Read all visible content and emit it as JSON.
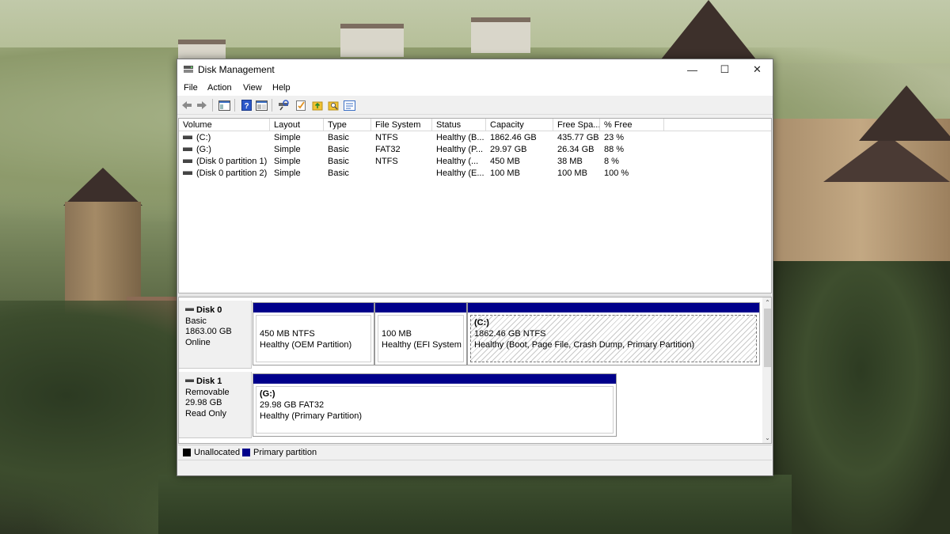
{
  "window": {
    "title": "Disk Management",
    "controls": {
      "minimize": "—",
      "maximize": "☐",
      "close": "✕"
    }
  },
  "menu": [
    "File",
    "Action",
    "View",
    "Help"
  ],
  "toolbar_icons": [
    "back-arrow-icon",
    "forward-arrow-icon",
    "console-tree-icon",
    "help-icon",
    "properties-icon",
    "rescan-disks-icon",
    "checklist-icon",
    "folder-up-icon",
    "folder-search-icon",
    "settings-panel-icon"
  ],
  "volume_list": {
    "columns": [
      "Volume",
      "Layout",
      "Type",
      "File System",
      "Status",
      "Capacity",
      "Free Spa...",
      "% Free"
    ],
    "rows": [
      [
        "(C:)",
        "Simple",
        "Basic",
        "NTFS",
        "Healthy (B...",
        "1862.46 GB",
        "435.77 GB",
        "23 %"
      ],
      [
        "(G:)",
        "Simple",
        "Basic",
        "FAT32",
        "Healthy (P...",
        "29.97 GB",
        "26.34 GB",
        "88 %"
      ],
      [
        "(Disk 0 partition 1)",
        "Simple",
        "Basic",
        "NTFS",
        "Healthy (...",
        "450 MB",
        "38 MB",
        "8 %"
      ],
      [
        "(Disk 0 partition 2)",
        "Simple",
        "Basic",
        "",
        "Healthy (E...",
        "100 MB",
        "100 MB",
        "100 %"
      ]
    ]
  },
  "disks": [
    {
      "name": "Disk 0",
      "type": "Basic",
      "size": "1863.00 GB",
      "state": "Online",
      "partitions": [
        {
          "title": "",
          "line1": "450 MB NTFS",
          "line2": "Healthy (OEM Partition)"
        },
        {
          "title": "",
          "line1": "100 MB",
          "line2": "Healthy (EFI System P"
        },
        {
          "title": "(C:)",
          "line1": "1862.46 GB NTFS",
          "line2": "Healthy (Boot, Page File, Crash Dump, Primary Partition)"
        }
      ]
    },
    {
      "name": "Disk 1",
      "type": "Removable",
      "size": "29.98 GB",
      "state": "Read Only",
      "partitions": [
        {
          "title": "(G:)",
          "line1": "29.98 GB FAT32",
          "line2": "Healthy (Primary Partition)"
        }
      ]
    }
  ],
  "legend": [
    {
      "label": "Unallocated",
      "color": "#000000"
    },
    {
      "label": "Primary partition",
      "color": "#00008b"
    }
  ],
  "scroll": {
    "up": "⌃",
    "down": "⌄"
  }
}
